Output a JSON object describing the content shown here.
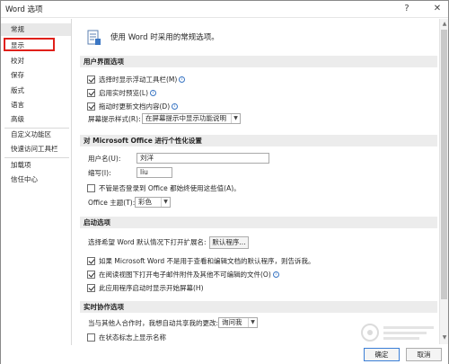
{
  "window": {
    "title": "Word 选项",
    "help_label": "?",
    "close_label": "✕"
  },
  "sidebar": {
    "items": [
      {
        "label": "常规"
      },
      {
        "label": "显示"
      },
      {
        "label": "校对"
      },
      {
        "label": "保存"
      },
      {
        "label": "版式"
      },
      {
        "label": "语言"
      },
      {
        "label": "高级"
      },
      {
        "label": "自定义功能区"
      },
      {
        "label": "快速访问工具栏"
      },
      {
        "label": "加载项"
      },
      {
        "label": "信任中心"
      }
    ],
    "active_index": 0,
    "highlighted_index": 1
  },
  "main": {
    "intro": "使用 Word 时采用的常规选项。",
    "ui_section": {
      "header": "用户界面选项",
      "options": [
        {
          "label": "选择时显示浮动工具栏(M)",
          "checked": true,
          "info": true
        },
        {
          "label": "启用实时预览(L)",
          "checked": true,
          "info": true
        },
        {
          "label": "拖动时更新文档内容(D)",
          "checked": true,
          "info": true
        }
      ],
      "tooltip_style_label": "屏幕提示样式(R):",
      "tooltip_style_value": "在屏幕提示中显示功能说明"
    },
    "personalize_section": {
      "header": "对 Microsoft Office 进行个性化设置",
      "username_label": "用户名(U):",
      "username_value": "刘洋",
      "initials_label": "缩写(I):",
      "initials_value": "liu",
      "always_use_label": "不管是否登录到 Office 都始终使用这些值(A)。",
      "always_use_checked": false,
      "theme_label": "Office 主题(T):",
      "theme_value": "彩色"
    },
    "startup_section": {
      "header": "启动选项",
      "default_program_label": "选择希望 Word 默认情况下打开扩展名:",
      "default_program_button": "默认程序...",
      "options": [
        {
          "label": "如果 Microsoft Word 不是用于查看和编辑文档的默认程序，则告诉我。",
          "checked": true,
          "info": false
        },
        {
          "label": "在阅读视图下打开电子邮件附件及其他不可编辑的文件(O)",
          "checked": true,
          "info": true
        },
        {
          "label": "此应用程序启动时显示开始屏幕(H)",
          "checked": true,
          "info": false
        }
      ]
    },
    "coauthor_section": {
      "header": "实时协作选项",
      "share_label": "当与其他人合作时，我想自动共享我的更改:",
      "share_value": "询问我",
      "show_names_label": "在状态标志上显示名称",
      "show_names_checked": false
    }
  },
  "footer": {
    "ok_label": "确定",
    "cancel_label": "取消"
  },
  "colors": {
    "highlight_box": "#e0201a",
    "section_header_bg": "#ececec",
    "info_icon": "#3a76c4"
  }
}
